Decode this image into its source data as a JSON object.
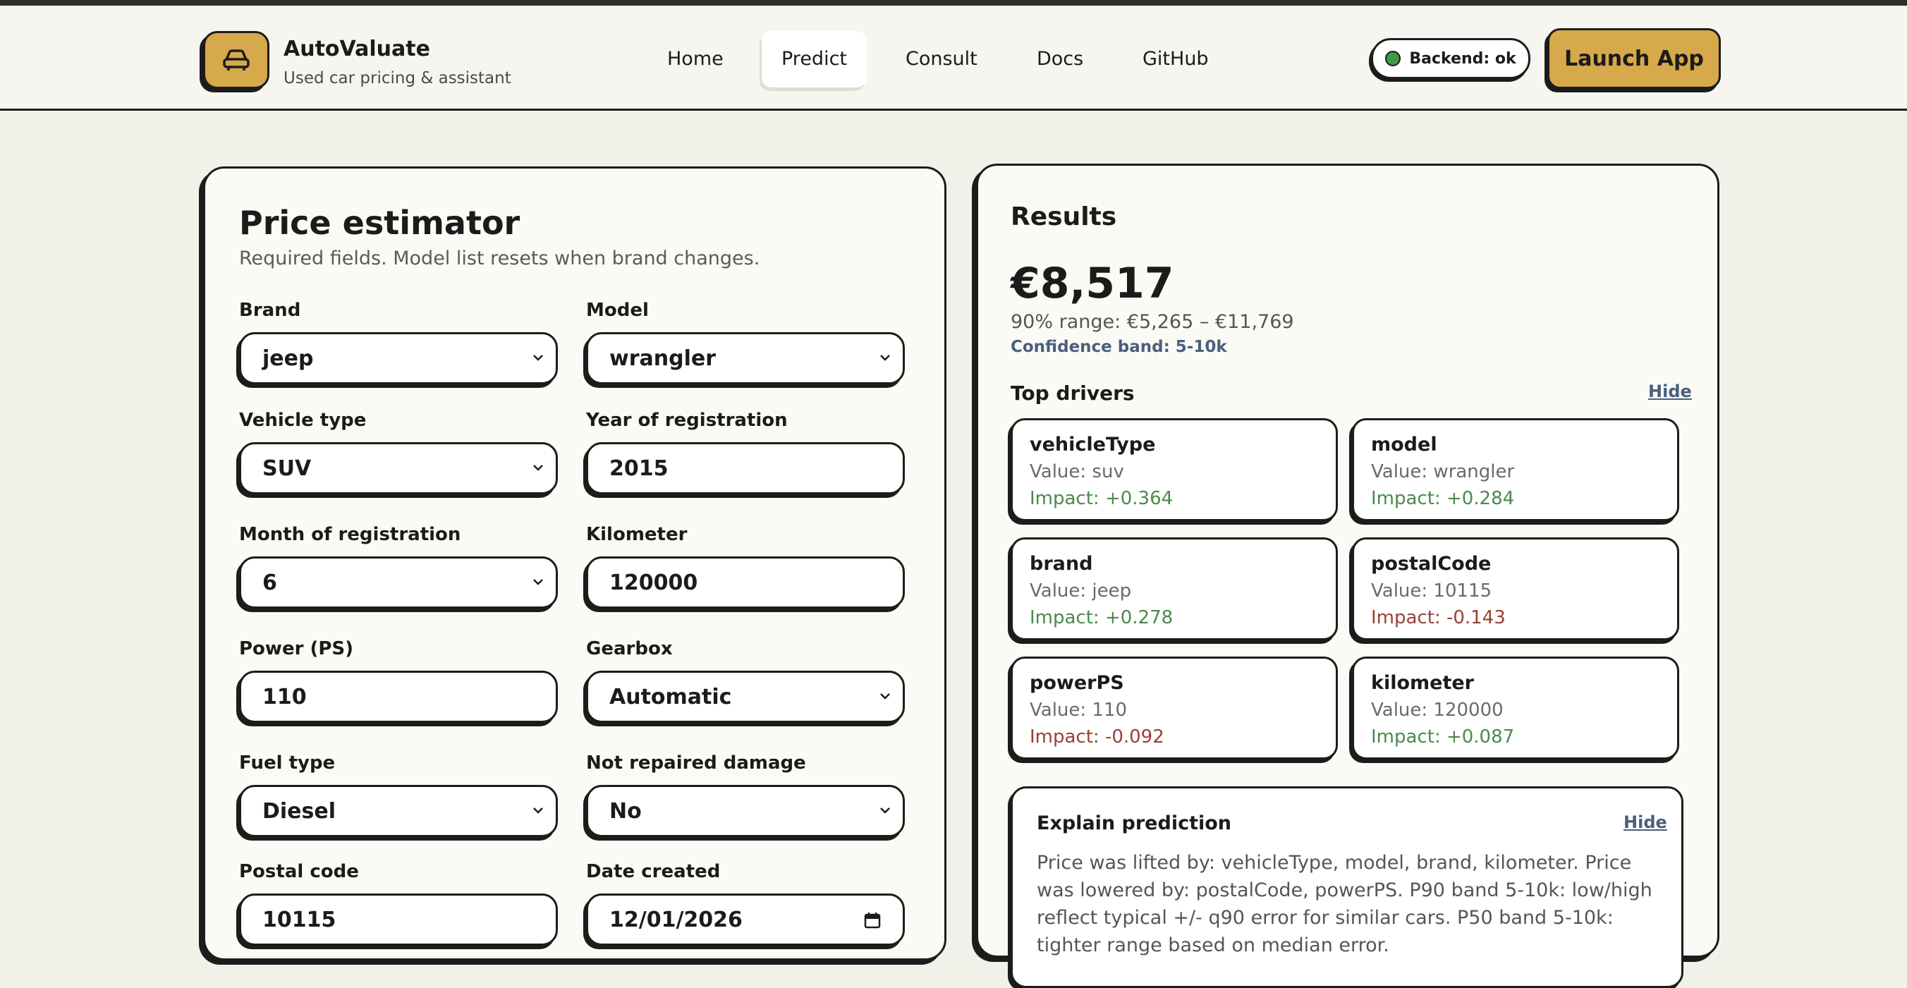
{
  "app": {
    "name": "AutoValuate",
    "tagline": "Used car pricing & assistant"
  },
  "nav": {
    "home": "Home",
    "predict": "Predict",
    "consult": "Consult",
    "docs": "Docs",
    "github": "GitHub"
  },
  "status": {
    "label": "Backend: ok",
    "color": "#3f9a4a"
  },
  "launch_label": "Launch App",
  "estimator": {
    "title": "Price estimator",
    "subtitle": "Required fields. Model list resets when brand changes.",
    "fields": {
      "brand": {
        "label": "Brand",
        "value": "jeep"
      },
      "model": {
        "label": "Model",
        "value": "wrangler"
      },
      "vehicle_type": {
        "label": "Vehicle type",
        "value": "SUV"
      },
      "year": {
        "label": "Year of registration",
        "value": "2015"
      },
      "month": {
        "label": "Month of registration",
        "value": "6"
      },
      "kilometer": {
        "label": "Kilometer",
        "value": "120000"
      },
      "power": {
        "label": "Power (PS)",
        "value": "110"
      },
      "gearbox": {
        "label": "Gearbox",
        "value": "Automatic"
      },
      "fuel": {
        "label": "Fuel type",
        "value": "Diesel"
      },
      "damage": {
        "label": "Not repaired damage",
        "value": "No"
      },
      "postal": {
        "label": "Postal code",
        "value": "10115"
      },
      "date": {
        "label": "Date created",
        "value": "12/01/2026"
      }
    }
  },
  "results": {
    "title": "Results",
    "price": "€8,517",
    "range": "90% range: €5,265 – €11,769",
    "band": "Confidence band: 5-10k",
    "drivers_title": "Top drivers",
    "hide_label": "Hide",
    "drivers": [
      {
        "name": "vehicleType",
        "value": "Value: suv",
        "impact": "Impact: +0.364"
      },
      {
        "name": "model",
        "value": "Value: wrangler",
        "impact": "Impact: +0.284"
      },
      {
        "name": "brand",
        "value": "Value: jeep",
        "impact": "Impact: +0.278"
      },
      {
        "name": "postalCode",
        "value": "Value: 10115",
        "impact": "Impact: -0.143"
      },
      {
        "name": "powerPS",
        "value": "Value: 110",
        "impact": "Impact: -0.092"
      },
      {
        "name": "kilometer",
        "value": "Value: 120000",
        "impact": "Impact: +0.087"
      }
    ],
    "explain": {
      "title": "Explain prediction",
      "hide_label": "Hide",
      "text": "Price was lifted by: vehicleType, model, brand, kilometer. Price was lowered by: postalCode, powerPS. P90 band 5-10k: low/high reflect typical +/- q90 error for similar cars. P50 band 5-10k: tighter range based on median error."
    }
  },
  "colors": {
    "accent": "#d6a94a",
    "positive": "#4a8a4c",
    "negative": "#9a3f36",
    "link": "#4a5f7e"
  }
}
